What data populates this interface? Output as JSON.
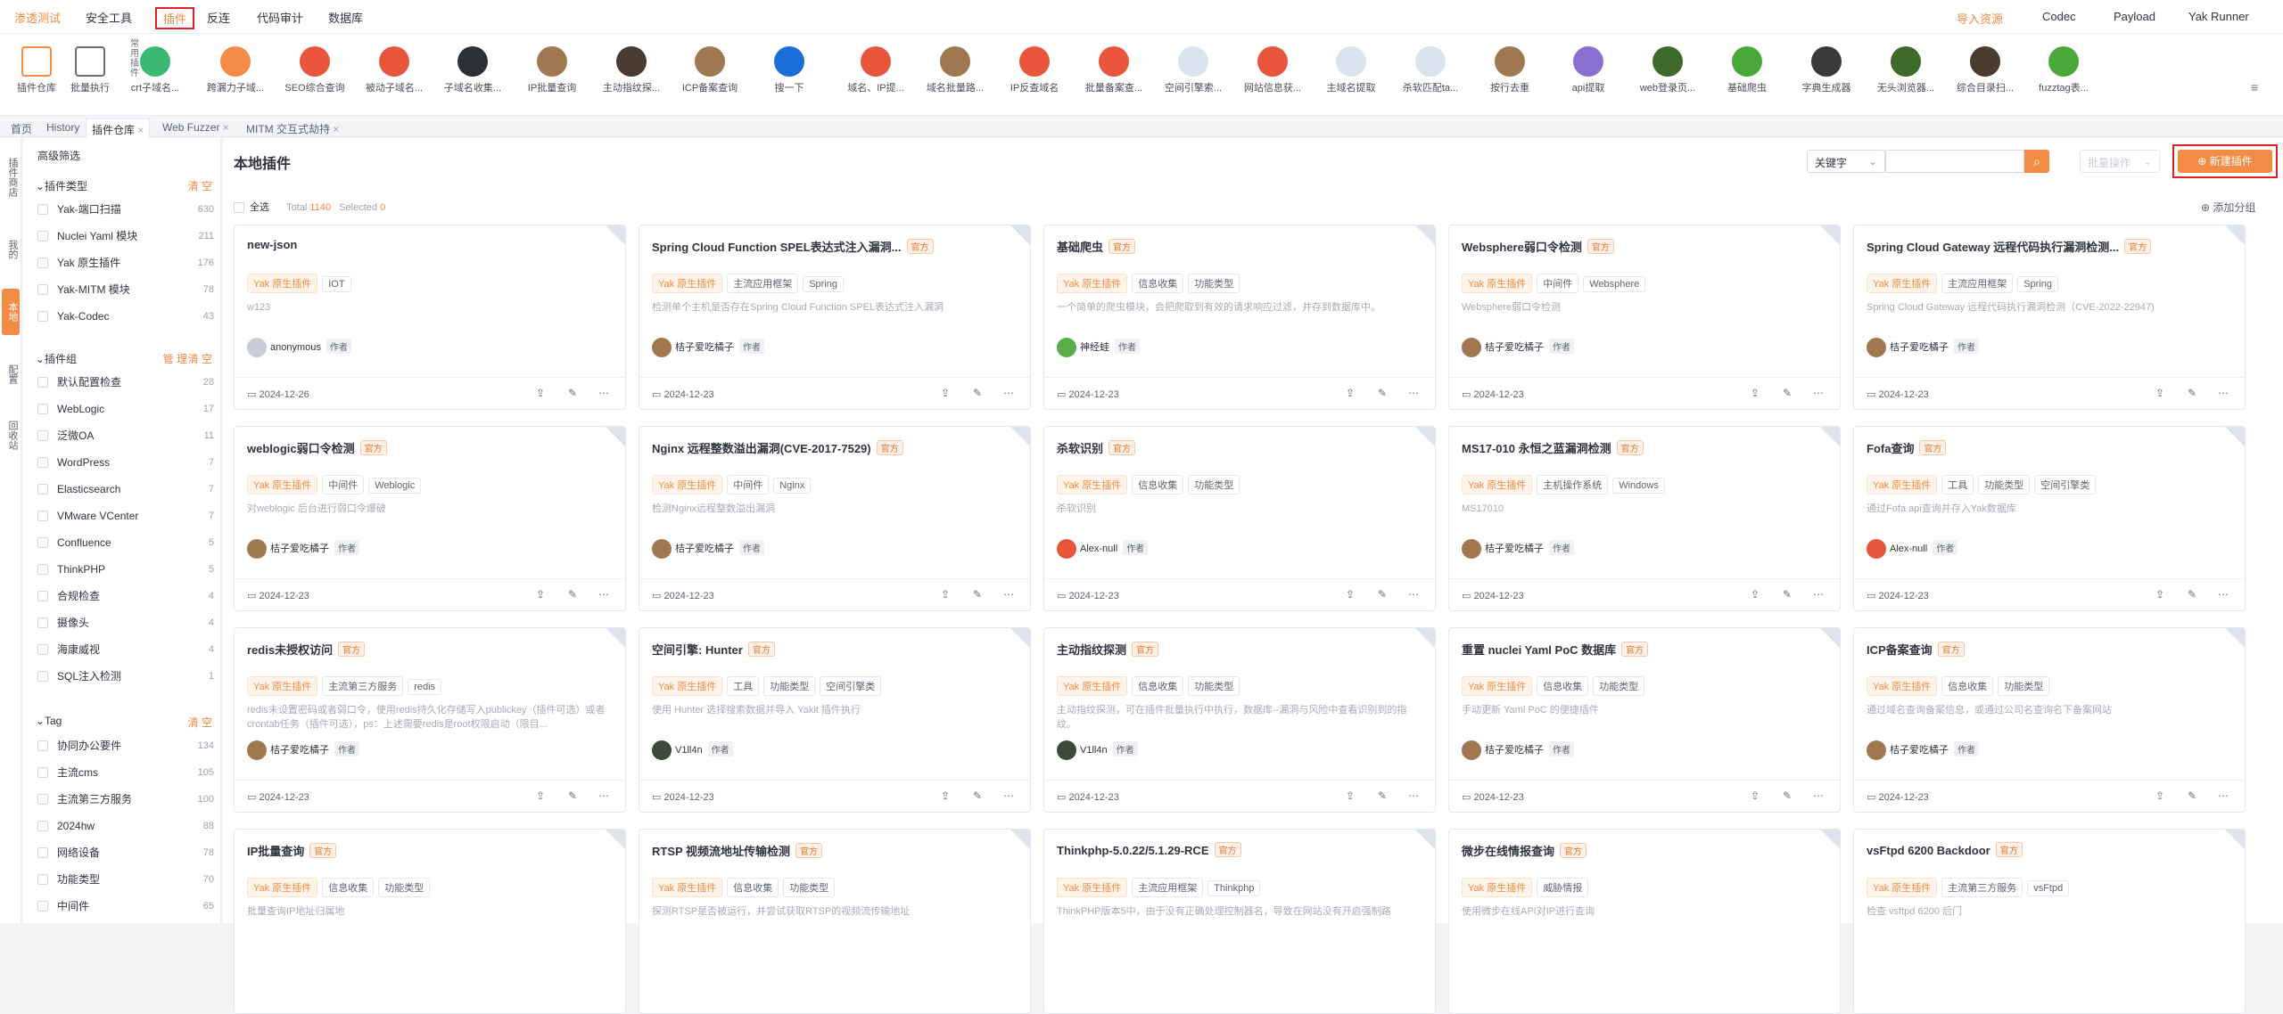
{
  "nav": {
    "menu": [
      "渗透测试",
      "安全工具",
      "插件",
      "反连",
      "代码审计",
      "数据库"
    ],
    "right": [
      "导入资源",
      "Codec",
      "Payload",
      "Yak Runner"
    ]
  },
  "toolbar": {
    "left_tools": [
      "插件仓库",
      "批量执行"
    ],
    "common_label": "常用插件",
    "tools": [
      "crt子域名...",
      "跨漏力子域...",
      "SEO综合查询",
      "被动子域名...",
      "子域名收集...",
      "IP批量查询",
      "主动指纹探...",
      "ICP备案查询",
      "搜一下",
      "域名、IP提...",
      "域名批量路...",
      "IP反查域名",
      "批量备案查...",
      "空间引擎索...",
      "网站信息获...",
      "主域名提取",
      "杀软匹配ta...",
      "按行去重",
      "api提取",
      "web登录页...",
      "基础爬虫",
      "字典生成器",
      "无头浏览器...",
      "综合目录扫...",
      "fuzztag表..."
    ]
  },
  "tabs": [
    "首页",
    "History",
    "插件仓库",
    "Web Fuzzer",
    "MITM 交互式劫持"
  ],
  "sidebar": [
    "插件商店",
    "我的",
    "本地",
    "配置",
    "回收站"
  ],
  "filter": {
    "advanced": "高级筛选",
    "clear": "清 空",
    "manage": "管 理",
    "sections": [
      {
        "title": "插件类型",
        "items": [
          {
            "name": "Yak-端口扫描",
            "count": "630"
          },
          {
            "name": "Nuclei Yaml 模块",
            "count": "211"
          },
          {
            "name": "Yak 原生插件",
            "count": "176"
          },
          {
            "name": "Yak-MITM 模块",
            "count": "78"
          },
          {
            "name": "Yak-Codec",
            "count": "43"
          }
        ]
      },
      {
        "title": "插件组",
        "items": [
          {
            "name": "默认配置检查",
            "count": "28"
          },
          {
            "name": "WebLogic",
            "count": "17"
          },
          {
            "name": "泛微OA",
            "count": "11"
          },
          {
            "name": "WordPress",
            "count": "7"
          },
          {
            "name": "Elasticsearch",
            "count": "7"
          },
          {
            "name": "VMware VCenter",
            "count": "7"
          },
          {
            "name": "Confluence",
            "count": "5"
          },
          {
            "name": "ThinkPHP",
            "count": "5"
          },
          {
            "name": "合规检查",
            "count": "4"
          },
          {
            "name": "摄像头",
            "count": "4"
          },
          {
            "name": "海康威视",
            "count": "4"
          },
          {
            "name": "SQL注入检测",
            "count": "1"
          }
        ]
      },
      {
        "title": "Tag",
        "items": [
          {
            "name": "协同办公要件",
            "count": "134"
          },
          {
            "name": "主流cms",
            "count": "105"
          },
          {
            "name": "主流第三方服务",
            "count": "100"
          },
          {
            "name": "2024hw",
            "count": "88"
          },
          {
            "name": "网络设备",
            "count": "78"
          },
          {
            "name": "功能类型",
            "count": "70"
          },
          {
            "name": "中间件",
            "count": "65"
          }
        ]
      }
    ]
  },
  "main": {
    "title": "本地插件",
    "keyword": "关键字",
    "batch": "批量操作",
    "new_plugin": "新建插件",
    "select_all": "全选",
    "total_label": "Total",
    "total": "1140",
    "selected_label": "Selected",
    "selected": "0",
    "add_group": "添加分组",
    "official": "官方",
    "author_role": "作者",
    "cards": [
      {
        "name": "new-json",
        "official": false,
        "tags": [
          "Yak 原生插件",
          "IOT"
        ],
        "desc": "w123",
        "author": "anonymous",
        "date": "2024-12-26",
        "av": "#c8ccd6"
      },
      {
        "name": "Spring Cloud Function SPEL表达式注入漏洞...",
        "official": true,
        "tags": [
          "Yak 原生插件",
          "主流应用框架",
          "Spring"
        ],
        "desc": "检测单个主机是否存在Spring Cloud Function SPEL表达式注入漏洞",
        "author": "桔子爱吃橘子",
        "date": "2024-12-23",
        "av": "#a07850"
      },
      {
        "name": "基础爬虫",
        "official": true,
        "tags": [
          "Yak 原生插件",
          "信息收集",
          "功能类型"
        ],
        "desc": "一个简单的爬虫模块，会把爬取到有效的请求响应过滤，并存到数据库中。",
        "author": "神经蛙",
        "date": "2024-12-23",
        "av": "#5aae4a"
      },
      {
        "name": "Websphere弱口令检测",
        "official": true,
        "tags": [
          "Yak 原生插件",
          "中间件",
          "Websphere"
        ],
        "desc": "Websphere弱口令检测",
        "author": "桔子爱吃橘子",
        "date": "2024-12-23",
        "av": "#a07850"
      },
      {
        "name": "Spring Cloud Gateway 远程代码执行漏洞检测...",
        "official": true,
        "tags": [
          "Yak 原生插件",
          "主流应用框架",
          "Spring"
        ],
        "desc": "Spring Cloud Gateway 远程代码执行漏洞检测（CVE-2022-22947)",
        "author": "桔子爱吃橘子",
        "date": "2024-12-23",
        "av": "#a07850"
      },
      {
        "name": "weblogic弱口令检测",
        "official": true,
        "tags": [
          "Yak 原生插件",
          "中间件",
          "Weblogic"
        ],
        "desc": "对weblogic 后台进行弱口令爆破",
        "author": "桔子爱吃橘子",
        "date": "2024-12-23",
        "av": "#a07850"
      },
      {
        "name": "Nginx 远程整数溢出漏洞(CVE-2017-7529)",
        "official": true,
        "tags": [
          "Yak 原生插件",
          "中间件",
          "Nginx"
        ],
        "desc": "检测Nginx远程整数溢出漏洞",
        "author": "桔子爱吃橘子",
        "date": "2024-12-23",
        "av": "#a07850"
      },
      {
        "name": "杀软识别",
        "official": true,
        "tags": [
          "Yak 原生插件",
          "信息收集",
          "功能类型"
        ],
        "desc": "杀软识别",
        "author": "Alex-null",
        "date": "2024-12-23",
        "av": "#e8553a"
      },
      {
        "name": "MS17-010 永恒之蓝漏洞检测",
        "official": true,
        "tags": [
          "Yak 原生插件",
          "主机操作系统",
          "Windows"
        ],
        "desc": "MS17010",
        "author": "桔子爱吃橘子",
        "date": "2024-12-23",
        "av": "#a07850"
      },
      {
        "name": "Fofa查询",
        "official": true,
        "tags": [
          "Yak 原生插件",
          "工具",
          "功能类型",
          "空间引擎类"
        ],
        "desc": "通过Fofa api查询并存入Yak数据库",
        "author": "Alex-null",
        "date": "2024-12-23",
        "av": "#e8553a"
      },
      {
        "name": "redis未授权访问",
        "official": true,
        "tags": [
          "Yak 原生插件",
          "主流第三方服务",
          "redis"
        ],
        "desc": "redis未设置密码或者弱口令，使用redis持久化存储写入publickey（插件可选）或者crontab任务（插件可选），ps：上述需要redis是root权限启动（限目...",
        "author": "桔子爱吃橘子",
        "date": "2024-12-23",
        "av": "#a07850"
      },
      {
        "name": "空间引擎: Hunter",
        "official": true,
        "tags": [
          "Yak 原生插件",
          "工具",
          "功能类型",
          "空间引擎类"
        ],
        "desc": "使用 Hunter 选择搜索数据并导入 Yakit 插件执行",
        "author": "V1ll4n",
        "date": "2024-12-23",
        "av": "#3d4a3a"
      },
      {
        "name": "主动指纹探测",
        "official": true,
        "tags": [
          "Yak 原生插件",
          "信息收集",
          "功能类型"
        ],
        "desc": "主动指纹探测，可在插件批量执行中执行，数据库--漏洞与风险中查看识别到的指纹。",
        "author": "V1ll4n",
        "date": "2024-12-23",
        "av": "#3d4a3a"
      },
      {
        "name": "重置 nuclei Yaml PoC 数据库",
        "official": true,
        "tags": [
          "Yak 原生插件",
          "信息收集",
          "功能类型"
        ],
        "desc": "手动更新 Yaml PoC 的便捷插件",
        "author": "桔子爱吃橘子",
        "date": "2024-12-23",
        "av": "#a07850"
      },
      {
        "name": "ICP备案查询",
        "official": true,
        "tags": [
          "Yak 原生插件",
          "信息收集",
          "功能类型"
        ],
        "desc": "通过域名查询备案信息，或通过公司名查询名下备案网站",
        "author": "桔子爱吃橘子",
        "date": "2024-12-23",
        "av": "#a07850"
      },
      {
        "name": "IP批量查询",
        "official": true,
        "tags": [
          "Yak 原生插件",
          "信息收集",
          "功能类型"
        ],
        "desc": "批量查询IP地址归属地",
        "author": "",
        "date": "",
        "av": "#a07850"
      },
      {
        "name": "RTSP 视频流地址传输检测",
        "official": true,
        "tags": [
          "Yak 原生插件",
          "信息收集",
          "功能类型"
        ],
        "desc": "探测RTSP是否被运行，并尝试获取RTSP的视频流传输地址",
        "author": "",
        "date": "",
        "av": "#a07850"
      },
      {
        "name": "Thinkphp-5.0.22/5.1.29-RCE",
        "official": true,
        "tags": [
          "Yak 原生插件",
          "主流应用框架",
          "Thinkphp"
        ],
        "desc": "ThinkPHP版本5中，由于没有正确处理控制器名，导致在网站没有开启强制路",
        "author": "",
        "date": "",
        "av": "#a07850"
      },
      {
        "name": "微步在线情报查询",
        "official": true,
        "tags": [
          "Yak 原生插件",
          "威胁情报"
        ],
        "desc": "使用微步在线API对IP进行查询",
        "author": "",
        "date": "",
        "av": "#a07850"
      },
      {
        "name": "vsFtpd 6200 Backdoor",
        "official": true,
        "tags": [
          "Yak 原生插件",
          "主流第三方服务",
          "vsFtpd"
        ],
        "desc": "检查 vsftpd 6200 后门",
        "author": "",
        "date": "",
        "av": "#a07850"
      }
    ]
  }
}
